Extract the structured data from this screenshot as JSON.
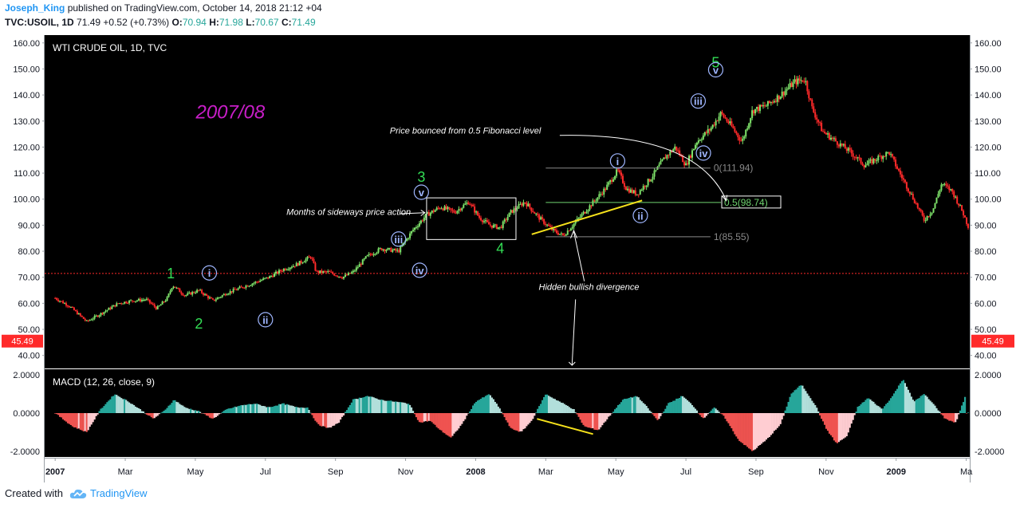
{
  "header": {
    "author": "Joseph_King",
    "published_text": "published on TradingView.com, October 14, 2018 21:12 +04",
    "symbol_line": "TVC:USOIL, 1D",
    "last": "71.49",
    "change": "+0.52 (+0.73%)",
    "o_label": "O:",
    "o_value": "70.94",
    "h_label": "H:",
    "h_value": "71.98",
    "l_label": "L:",
    "l_value": "70.67",
    "c_label": "C:",
    "c_value": "71.49"
  },
  "footer": {
    "created_with": "Created with",
    "brand": "TradingView"
  },
  "colors": {
    "background": "#000000",
    "up": "#7ee26a",
    "down": "#ff2a2a",
    "wave_label": "#33dd55",
    "roman_label": "#9fb6ff",
    "year_label": "#c81ec8",
    "hist_up_dark": "#26a69a",
    "hist_up_light": "#b2dfdb",
    "hist_down_dark": "#ef5350",
    "hist_down_light": "#ffcdd2",
    "divergence_line": "#f5e11b",
    "price_line": "#ff2a2a"
  },
  "chart_data": [
    {
      "type": "candlestick",
      "title": "WTI CRUDE OIL, 1D, TVC",
      "ylim": [
        35,
        163
      ],
      "y_ticks": [
        "160.00",
        "150.00",
        "140.00",
        "130.00",
        "120.00",
        "110.00",
        "100.00",
        "90.00",
        "80.00",
        "70.00",
        "60.00",
        "50.00",
        "40.00"
      ],
      "y_tick_values": [
        160,
        150,
        140,
        130,
        120,
        110,
        100,
        90,
        80,
        70,
        60,
        50,
        40
      ],
      "x_ticks": [
        "2007",
        "Mar",
        "May",
        "Jul",
        "Sep",
        "Nov",
        "2008",
        "Mar",
        "May",
        "Jul",
        "Sep",
        "Nov",
        "2009",
        "Ma"
      ],
      "x_tick_months": [
        0,
        2,
        4,
        6,
        8,
        10,
        12,
        14,
        16,
        18,
        20,
        22,
        24,
        26
      ],
      "x_month_range": [
        -0.3,
        26.1
      ],
      "last_price_label": "45.49",
      "last_price_value": 45.49,
      "current_price_line": 71.49,
      "price_path": [
        [
          0.0,
          62
        ],
        [
          0.4,
          59
        ],
        [
          0.9,
          53
        ],
        [
          1.3,
          56
        ],
        [
          1.8,
          60
        ],
        [
          2.2,
          61
        ],
        [
          2.6,
          61.5
        ],
        [
          2.9,
          58
        ],
        [
          3.2,
          62
        ],
        [
          3.35,
          67
        ],
        [
          3.7,
          63
        ],
        [
          4.1,
          65
        ],
        [
          4.5,
          61
        ],
        [
          4.9,
          64
        ],
        [
          5.3,
          66
        ],
        [
          5.7,
          68
        ],
        [
          6.1,
          70
        ],
        [
          6.5,
          73
        ],
        [
          6.9,
          75
        ],
        [
          7.3,
          78
        ],
        [
          7.45,
          72
        ],
        [
          7.8,
          72
        ],
        [
          8.2,
          70
        ],
        [
          8.5,
          72
        ],
        [
          8.9,
          78
        ],
        [
          9.3,
          81
        ],
        [
          9.8,
          80
        ],
        [
          10.2,
          88
        ],
        [
          10.6,
          94
        ],
        [
          11.0,
          97
        ],
        [
          11.4,
          95
        ],
        [
          11.8,
          99
        ],
        [
          12.1,
          93
        ],
        [
          12.4,
          90
        ],
        [
          12.7,
          89
        ],
        [
          13.0,
          95
        ],
        [
          13.4,
          99
        ],
        [
          13.8,
          93
        ],
        [
          14.2,
          88
        ],
        [
          14.5,
          86
        ],
        [
          14.9,
          92
        ],
        [
          15.3,
          98
        ],
        [
          15.7,
          104
        ],
        [
          16.05,
          111
        ],
        [
          16.3,
          104
        ],
        [
          16.6,
          102
        ],
        [
          17.0,
          108
        ],
        [
          17.4,
          116
        ],
        [
          17.7,
          120
        ],
        [
          18.0,
          113
        ],
        [
          18.3,
          122
        ],
        [
          18.7,
          127
        ],
        [
          19.0,
          133
        ],
        [
          19.3,
          128
        ],
        [
          19.6,
          122
        ],
        [
          19.9,
          134
        ],
        [
          20.3,
          136
        ],
        [
          20.7,
          140
        ],
        [
          21.1,
          145
        ],
        [
          21.4,
          146
        ],
        [
          21.6,
          135
        ],
        [
          21.9,
          126
        ],
        [
          22.3,
          122
        ],
        [
          22.7,
          118
        ],
        [
          23.1,
          113
        ],
        [
          23.5,
          116
        ],
        [
          23.8,
          118
        ],
        [
          24.1,
          110
        ],
        [
          24.5,
          100
        ],
        [
          24.8,
          92
        ],
        [
          25.05,
          96
        ],
        [
          25.3,
          106
        ],
        [
          25.6,
          103
        ],
        [
          25.9,
          95
        ],
        [
          26.1,
          88
        ]
      ],
      "waves": [
        {
          "label": "1",
          "month": 3.3,
          "price": 66,
          "pos": "above",
          "style": "digit"
        },
        {
          "label": "2",
          "month": 4.1,
          "price": 57,
          "pos": "below",
          "style": "digit"
        },
        {
          "label": "3",
          "month": 10.45,
          "price": 103,
          "pos": "above",
          "style": "digit"
        },
        {
          "label": "4",
          "month": 12.7,
          "price": 86,
          "pos": "below",
          "style": "digit"
        },
        {
          "label": "5",
          "month": 18.85,
          "price": 147,
          "pos": "above",
          "style": "digit"
        },
        {
          "label": "i",
          "month": 4.4,
          "price": 68,
          "pos": "above",
          "style": "roman"
        },
        {
          "label": "ii",
          "month": 6.0,
          "price": 58,
          "pos": "below",
          "style": "roman"
        },
        {
          "label": "iii",
          "month": 9.8,
          "price": 81,
          "pos": "above",
          "style": "roman"
        },
        {
          "label": "iv",
          "month": 10.4,
          "price": 77,
          "pos": "below",
          "style": "roman"
        },
        {
          "label": "v",
          "month": 10.45,
          "price": 99,
          "pos": "above",
          "style": "roman"
        },
        {
          "label": "i",
          "month": 16.05,
          "price": 111,
          "pos": "above",
          "style": "roman"
        },
        {
          "label": "ii",
          "month": 16.7,
          "price": 98,
          "pos": "below",
          "style": "roman"
        },
        {
          "label": "iii",
          "month": 18.35,
          "price": 134,
          "pos": "above",
          "style": "roman"
        },
        {
          "label": "iv",
          "month": 18.5,
          "price": 122,
          "pos": "below",
          "style": "roman"
        },
        {
          "label": "v",
          "month": 18.85,
          "price": 146,
          "pos": "above",
          "style": "roman"
        }
      ],
      "fibonacci": [
        {
          "label": "0(111.94)",
          "value": 111.94,
          "start": 14.0,
          "end": 18.7,
          "color": "#8a8a8a"
        },
        {
          "label": "0.5(98.74)",
          "value": 98.74,
          "start": 14.0,
          "end": 19.0,
          "color": "#6fd36f"
        },
        {
          "label": "1(85.55)",
          "value": 85.55,
          "start": 14.0,
          "end": 18.7,
          "color": "#8a8a8a"
        }
      ],
      "annotations": [
        {
          "text": "2007/08",
          "month": 5.0,
          "price": 131,
          "kind": "year"
        },
        {
          "text": "Price bounced from 0.5 Fibonacci level",
          "month": 9.55,
          "price": 125.2,
          "kind": "note"
        },
        {
          "text": "Months of sideways price action",
          "month": 6.6,
          "price": 94,
          "kind": "note"
        },
        {
          "text": "Hidden bullish divergence",
          "month": 13.8,
          "price": 65.2,
          "kind": "note"
        }
      ],
      "box": {
        "start_month": 10.6,
        "end_month": 13.15,
        "top": 100.5,
        "bottom": 84.5
      }
    },
    {
      "type": "histogram",
      "title": "MACD (12, 26, close, 9)",
      "ylim": [
        -2.3,
        2.3
      ],
      "y_ticks": [
        "2.0000",
        "0.0000",
        "-2.0000"
      ],
      "y_tick_values": [
        2,
        0,
        -2
      ],
      "wave_points": [
        [
          0,
          0
        ],
        [
          0.5,
          -0.7
        ],
        [
          0.9,
          -1.0
        ],
        [
          1.3,
          0.2
        ],
        [
          1.7,
          1.0
        ],
        [
          2.1,
          0.6
        ],
        [
          2.5,
          0.1
        ],
        [
          2.8,
          -0.3
        ],
        [
          3.1,
          0.1
        ],
        [
          3.4,
          0.7
        ],
        [
          3.7,
          0.3
        ],
        [
          4.1,
          0.1
        ],
        [
          4.5,
          -0.3
        ],
        [
          4.9,
          0.2
        ],
        [
          5.3,
          0.4
        ],
        [
          5.7,
          0.5
        ],
        [
          6.1,
          0.3
        ],
        [
          6.5,
          0.5
        ],
        [
          6.9,
          0.3
        ],
        [
          7.2,
          0.3
        ],
        [
          7.5,
          -0.6
        ],
        [
          7.8,
          -0.8
        ],
        [
          8.1,
          -0.5
        ],
        [
          8.5,
          0.7
        ],
        [
          8.9,
          0.9
        ],
        [
          9.3,
          0.7
        ],
        [
          9.7,
          0.6
        ],
        [
          10.1,
          0.5
        ],
        [
          10.4,
          -0.5
        ],
        [
          10.7,
          -0.4
        ],
        [
          11.0,
          -0.9
        ],
        [
          11.3,
          -1.3
        ],
        [
          11.6,
          -0.6
        ],
        [
          12.0,
          0.6
        ],
        [
          12.4,
          1.0
        ],
        [
          12.7,
          0.2
        ],
        [
          13.0,
          -0.8
        ],
        [
          13.3,
          -1.0
        ],
        [
          13.6,
          -0.4
        ],
        [
          14.0,
          1.0
        ],
        [
          14.4,
          0.6
        ],
        [
          14.8,
          0.2
        ],
        [
          15.1,
          -0.7
        ],
        [
          15.5,
          -0.9
        ],
        [
          15.8,
          -0.2
        ],
        [
          16.2,
          0.7
        ],
        [
          16.6,
          0.9
        ],
        [
          16.9,
          0.3
        ],
        [
          17.2,
          -0.4
        ],
        [
          17.5,
          0.5
        ],
        [
          17.9,
          0.9
        ],
        [
          18.2,
          0.4
        ],
        [
          18.5,
          -0.3
        ],
        [
          18.8,
          0.3
        ],
        [
          19.1,
          -0.2
        ],
        [
          19.5,
          -1.4
        ],
        [
          19.9,
          -2.0
        ],
        [
          20.3,
          -1.4
        ],
        [
          20.7,
          -0.6
        ],
        [
          21.0,
          1.0
        ],
        [
          21.3,
          1.5
        ],
        [
          21.7,
          0.4
        ],
        [
          22.0,
          -0.8
        ],
        [
          22.3,
          -1.6
        ],
        [
          22.6,
          -1.2
        ],
        [
          22.9,
          0.3
        ],
        [
          23.2,
          0.8
        ],
        [
          23.6,
          0.2
        ],
        [
          23.9,
          0.9
        ],
        [
          24.2,
          1.8
        ],
        [
          24.5,
          0.6
        ],
        [
          24.8,
          1.0
        ],
        [
          25.1,
          0.4
        ],
        [
          25.4,
          -0.3
        ],
        [
          25.7,
          -0.5
        ],
        [
          26.0,
          1.0
        ]
      ],
      "divergence_line": [
        [
          13.75,
          -0.3
        ],
        [
          15.35,
          -1.1
        ]
      ]
    }
  ]
}
